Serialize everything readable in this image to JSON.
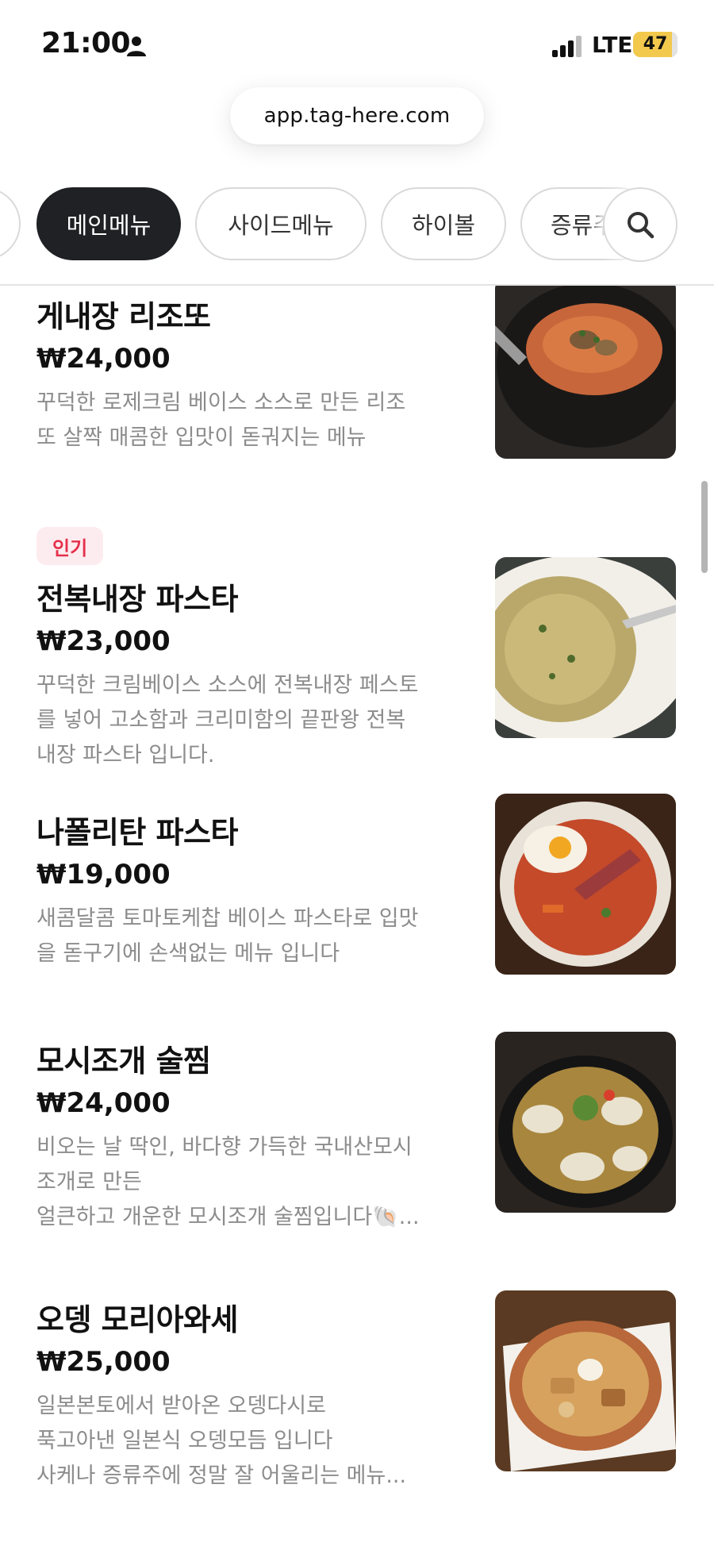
{
  "status_bar": {
    "time": "21:00",
    "network": "LTE",
    "battery": "47",
    "battery_level_percent": 47,
    "icons": [
      "person-icon",
      "signal-icon",
      "battery-icon"
    ]
  },
  "browser": {
    "url": "app.tag-here.com"
  },
  "tabs": [
    {
      "label": "",
      "active": false
    },
    {
      "label": "메인메뉴",
      "active": true
    },
    {
      "label": "사이드메뉴",
      "active": false
    },
    {
      "label": "하이볼",
      "active": false
    },
    {
      "label": "증류주",
      "active": false
    }
  ],
  "search": {
    "icon": "search-icon"
  },
  "menu_items": [
    {
      "name": "게내장 리조또",
      "price": "₩24,000",
      "description": [
        "꾸덕한 로제크림 베이스 소스로 만든 리조",
        "또 살짝 매콤한 입맛이 돋궈지는 메뉴"
      ]
    },
    {
      "badge": "인기",
      "name": "전복내장 파스타",
      "price": "₩23,000",
      "description": [
        "꾸덕한 크림베이스 소스에 전복내장 페스토",
        "를 넣어 고소함과 크리미함의 끝판왕 전복",
        "내장 파스타 입니다."
      ]
    },
    {
      "name": "나폴리탄 파스타",
      "price": "₩19,000",
      "description": [
        "새콤달콤 토마토케찹 베이스 파스타로 입맛",
        "을 돋구기에 손색없는 메뉴 입니다"
      ]
    },
    {
      "name": "모시조개 술찜",
      "price": "₩24,000",
      "description": [
        "비오는 날 딱인, 바다향 가득한 국내산모시",
        "조개로 만든",
        "얼큰하고 개운한 모시조개 술찜입니다🐚..."
      ]
    },
    {
      "name": "오뎅 모리아와세",
      "price": "₩25,000",
      "description": [
        "일본본토에서 받아온 오뎅다시로",
        "푹고아낸 일본식 오뎅모듬 입니다",
        "사케나 증류주에 정말 잘 어울리는 메뉴..."
      ]
    }
  ]
}
